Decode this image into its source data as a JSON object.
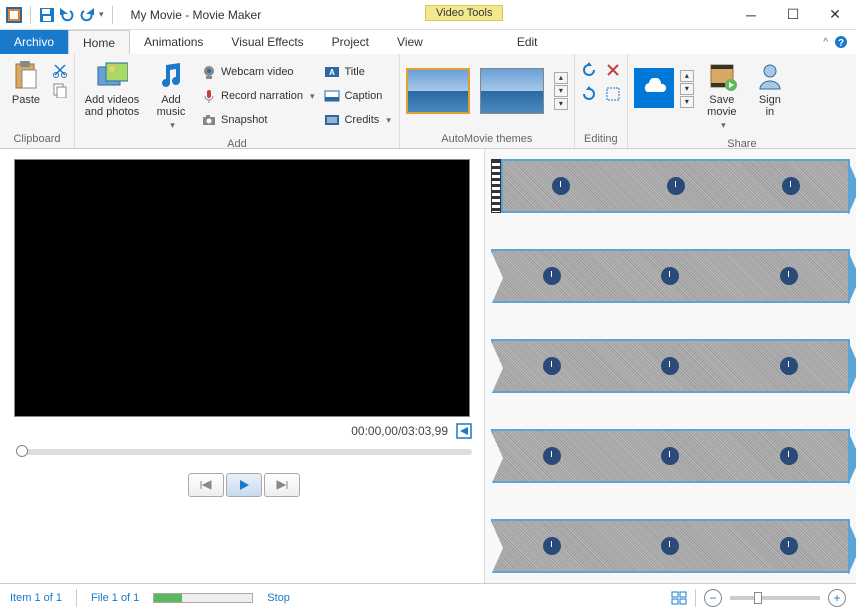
{
  "titlebar": {
    "title": "My Movie - Movie Maker",
    "context_tab": "Video Tools"
  },
  "tabs": {
    "file": "Archivo",
    "home": "Home",
    "animations": "Animations",
    "visual_effects": "Visual Effects",
    "project": "Project",
    "view": "View",
    "edit": "Edit"
  },
  "ribbon": {
    "clipboard": {
      "label": "Clipboard",
      "paste": "Paste"
    },
    "add": {
      "label": "Add",
      "add_videos": "Add videos\nand photos",
      "add_music": "Add\nmusic",
      "webcam": "Webcam video",
      "record": "Record narration",
      "snapshot": "Snapshot",
      "title": "Title",
      "caption": "Caption",
      "credits": "Credits"
    },
    "automovie": {
      "label": "AutoMovie themes"
    },
    "editing": {
      "label": "Editing"
    },
    "share": {
      "label": "Share",
      "save_movie": "Save\nmovie",
      "sign_in": "Sign\nin"
    }
  },
  "preview": {
    "time": "00:00,00/03:03,99"
  },
  "statusbar": {
    "item_count": "Item 1 of 1",
    "file_count": "File 1 of 1",
    "stop": "Stop"
  }
}
